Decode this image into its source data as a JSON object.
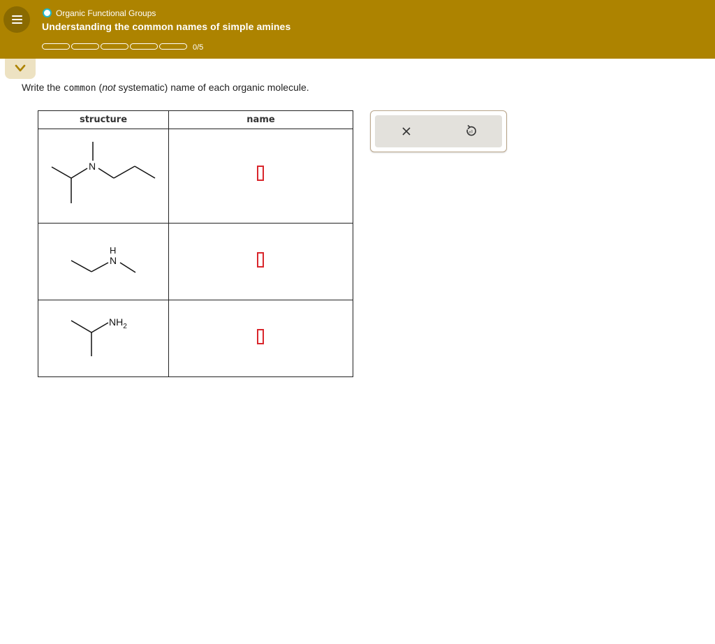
{
  "header": {
    "topic": "Organic Functional Groups",
    "title": "Understanding the common names of simple amines",
    "progress_text": "0/5",
    "progress_segments": 5,
    "progress_completed": 0,
    "background_color": "#ad8300",
    "icons": {
      "menu": "menu-icon",
      "topic_status": "status-circle-icon",
      "collapse": "chevron-down-icon"
    }
  },
  "question": {
    "part1": "Write the ",
    "part2": "common",
    "part3": " (",
    "part4": "not",
    "part5": " systematic) name of each organic molecule."
  },
  "table": {
    "headers": {
      "structure": "structure",
      "name": "name"
    },
    "rows": [
      {
        "label_N": "N",
        "name_value": ""
      },
      {
        "label_H": "H",
        "label_N": "N",
        "name_value": ""
      },
      {
        "label_NH": "NH",
        "label_sub": "2",
        "name_value": ""
      }
    ]
  },
  "actions": {
    "clear_icon": "close-icon",
    "undo_icon": "undo-icon"
  },
  "colors": {
    "answer_box_border": "#d9262c",
    "accent_cyan": "#1fb6c9"
  }
}
